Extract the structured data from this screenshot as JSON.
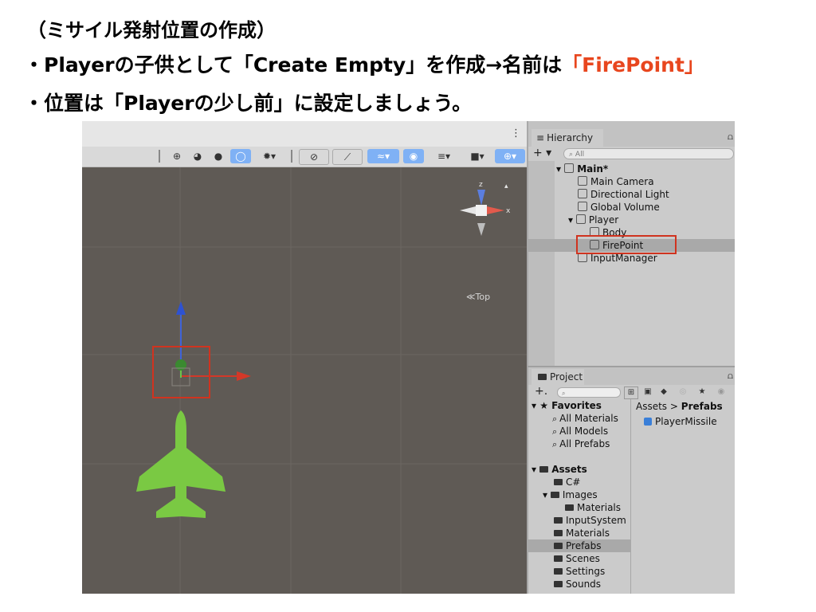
{
  "slide": {
    "title": "（ミサイル発射位置の作成）",
    "bullet1_prefix": "・Playerの子供として「Create Empty」を作成→名前は",
    "bullet1_accent": "「FirePoint」",
    "bullet2": "・位置は「Playerの少し前」に設定しましょう。",
    "accent_color": "#e8461e"
  },
  "scene": {
    "menu_icon": "⋮",
    "toolbar_icons": [
      "divider-icon",
      "grid-icon",
      "globe-icon",
      "sphere-icon",
      "orbit-icon",
      "bug-icon",
      "divider-icon",
      "audio-mute-icon",
      "fx-icon",
      "layers-icon",
      "eye-icon",
      "layers2-icon",
      "camera-icon",
      "gizmo-icon"
    ],
    "orientation_label": "≪Top",
    "gizmo_axes": {
      "z": "z",
      "x": "x"
    },
    "player_color": "#7ac943",
    "highlight_color": "#d0331f"
  },
  "hierarchy": {
    "tab_label": "Hierarchy",
    "search_placeholder": "All",
    "items": [
      {
        "label": "Main*",
        "level": 0
      },
      {
        "label": "Main Camera",
        "level": 1
      },
      {
        "label": "Directional Light",
        "level": 1
      },
      {
        "label": "Global Volume",
        "level": 1
      },
      {
        "label": "Player",
        "level": 1
      },
      {
        "label": "Body",
        "level": 2
      },
      {
        "label": "FirePoint",
        "level": 2,
        "selected": true
      },
      {
        "label": "InputManager",
        "level": 1
      }
    ]
  },
  "project": {
    "tab_label": "Project",
    "breadcrumb": {
      "root": "Assets",
      "separator": ">",
      "current": "Prefabs"
    },
    "favorites": {
      "label": "Favorites",
      "items": [
        "All Materials",
        "All Models",
        "All Prefabs"
      ]
    },
    "assets": {
      "label": "Assets",
      "items": [
        {
          "label": "C#",
          "level": 1
        },
        {
          "label": "Images",
          "level": 1
        },
        {
          "label": "Materials",
          "level": 2
        },
        {
          "label": "InputSystem",
          "level": 1
        },
        {
          "label": "Materials",
          "level": 1
        },
        {
          "label": "Prefabs",
          "level": 1,
          "selected": true
        },
        {
          "label": "Scenes",
          "level": 1
        },
        {
          "label": "Settings",
          "level": 1
        },
        {
          "label": "Sounds",
          "level": 1
        }
      ]
    },
    "files": [
      "PlayerMissile"
    ]
  }
}
